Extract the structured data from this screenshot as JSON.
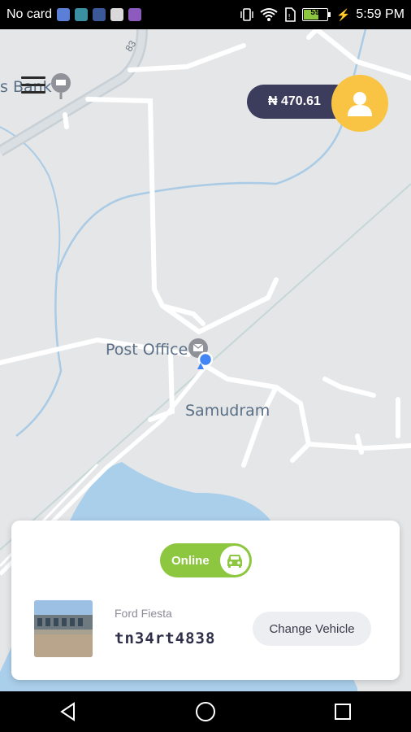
{
  "status_bar": {
    "carrier": "No card",
    "battery_level": "59",
    "time": "5:59 PM",
    "icons": [
      "notification-icon",
      "notification-icon",
      "facebook-icon",
      "notification-icon",
      "notification-icon",
      "vibrate-icon",
      "wifi-icon",
      "sim-icon",
      "battery-icon",
      "charging-icon"
    ]
  },
  "map": {
    "labels": {
      "bank": "s Bank",
      "post_office": "Post Office",
      "area": "Samudram",
      "route": "83"
    },
    "colors": {
      "land": "#e4e6e8",
      "road": "#ffffff",
      "water": "#aacfeb",
      "river": "#a9cbe6"
    }
  },
  "header": {
    "balance": "₦ 470.61",
    "colors": {
      "pill": "#3c3c5c",
      "avatar": "#f9c443"
    }
  },
  "driver_card": {
    "status_label": "Online",
    "vehicle_model": "Ford Fiesta",
    "vehicle_plate": "tn34rt4838",
    "change_button": "Change Vehicle",
    "colors": {
      "online": "#8dc63f"
    }
  },
  "nav_bar": {
    "buttons": [
      "back",
      "home",
      "recents"
    ]
  }
}
